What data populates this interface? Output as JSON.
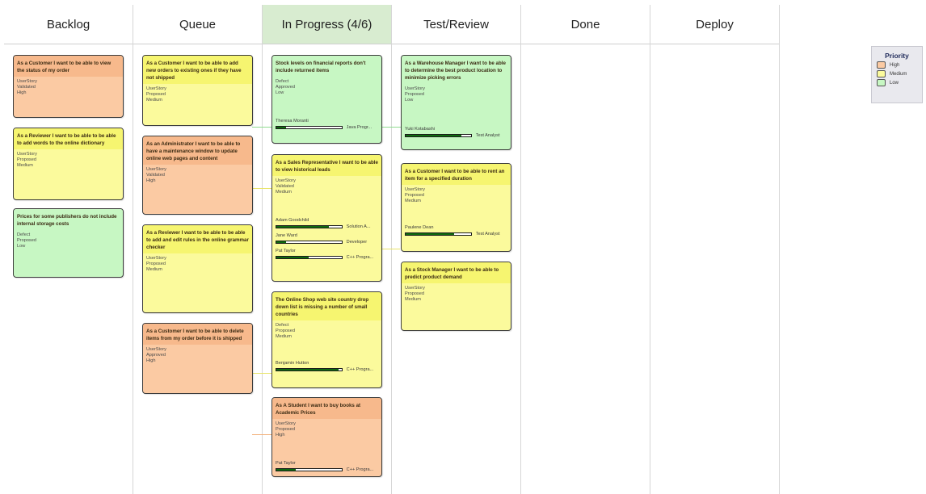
{
  "columns": [
    {
      "name": "Backlog"
    },
    {
      "name": "Queue"
    },
    {
      "name": "In Progress (4/6)"
    },
    {
      "name": "Test/Review"
    },
    {
      "name": "Done"
    },
    {
      "name": "Deploy"
    }
  ],
  "colors": {
    "high": "#fbcaa3",
    "medium": "#fbfa9c",
    "low": "#c7f7c3",
    "active_column_header": "#d8ecd0",
    "progress_fill": "#0f6a0f"
  },
  "cards": {
    "backlog": [
      {
        "title": "As a Customer I want to be able to view the status of my order",
        "type": "UserStory",
        "status": "Validated",
        "priority": "High"
      },
      {
        "title": "As a Reviewer I want to be able to be able to add words to the online dictionary",
        "type": "UserStory",
        "status": "Proposed",
        "priority": "Medium"
      },
      {
        "title": "Prices for some publishers do not include internal storage costs",
        "type": "Defect",
        "status": "Proposed",
        "priority": "Low"
      }
    ],
    "queue": [
      {
        "title": "As a Customer I want to be able to add new orders to existing ones if they have not shipped",
        "type": "UserStory",
        "status": "Proposed",
        "priority": "Medium"
      },
      {
        "title": "As an Administrator I want to be able to have a maintenance window to update online web pages and content",
        "type": "UserStory",
        "status": "Validated",
        "priority": "High"
      },
      {
        "title": "As a Reviewer I want to be able to be able to add and edit rules in the online grammar checker",
        "type": "UserStory",
        "status": "Proposed",
        "priority": "Medium"
      },
      {
        "title": "As a Customer I want to be able to delete items from my order before it is shipped",
        "type": "UserStory",
        "status": "Approved",
        "priority": "High"
      }
    ],
    "in_progress": [
      {
        "title": "Stock levels on financial reports don't include returned items",
        "type": "Defect",
        "status": "Approved",
        "priority": "Low",
        "assignees": [
          {
            "name": "Theresa Moranti",
            "role": "Java Progr...",
            "progress": 0.15
          }
        ]
      },
      {
        "title": "As a Sales Representative I want to be able to view historical leads",
        "type": "UserStory",
        "status": "Validated",
        "priority": "Medium",
        "assignees": [
          {
            "name": "Adam Goodchild",
            "role": "Solution A...",
            "progress": 0.8
          },
          {
            "name": "Jane Ward",
            "role": "Developer",
            "progress": 0.15
          },
          {
            "name": "Pat Taylor",
            "role": "C++ Progra...",
            "progress": 0.5
          }
        ]
      },
      {
        "title": "The Online Shop web site country drop down list is missing a number of small countries",
        "type": "Defect",
        "status": "Proposed",
        "priority": "Medium",
        "assignees": [
          {
            "name": "Benjamin Hutton",
            "role": "C++ Progra...",
            "progress": 0.95
          }
        ]
      },
      {
        "title": "As A Student I want to buy books at Academic Prices",
        "type": "UserStory",
        "status": "Proposed",
        "priority": "High",
        "assignees": [
          {
            "name": "Pat Taylor",
            "role": "C++ Progra...",
            "progress": 0.3
          }
        ]
      }
    ],
    "test_review": [
      {
        "title": "As a Warehouse Manager I want to be able to determine the best product location to minimize picking errors",
        "type": "UserStory",
        "status": "Proposed",
        "priority": "Low",
        "assignees": [
          {
            "name": "Yuki Kotabashi",
            "role": "Test Analyst",
            "progress": 0.85
          }
        ]
      },
      {
        "title": "As a Customer I want to be able to rent an item for a specified duration",
        "type": "UserStory",
        "status": "Proposed",
        "priority": "Medium",
        "assignees": [
          {
            "name": "Paulene Dean",
            "role": "Test Analyst",
            "progress": 0.75
          }
        ]
      },
      {
        "title": "As a Stock Manager I want to be able to predict product demand",
        "type": "UserStory",
        "status": "Proposed",
        "priority": "Medium"
      }
    ]
  },
  "legend": {
    "title": "Priority",
    "items": [
      {
        "label": "High",
        "color": "#fbcaa3"
      },
      {
        "label": "Medium",
        "color": "#fbfa9c"
      },
      {
        "label": "Low",
        "color": "#c7f7c3"
      }
    ]
  }
}
